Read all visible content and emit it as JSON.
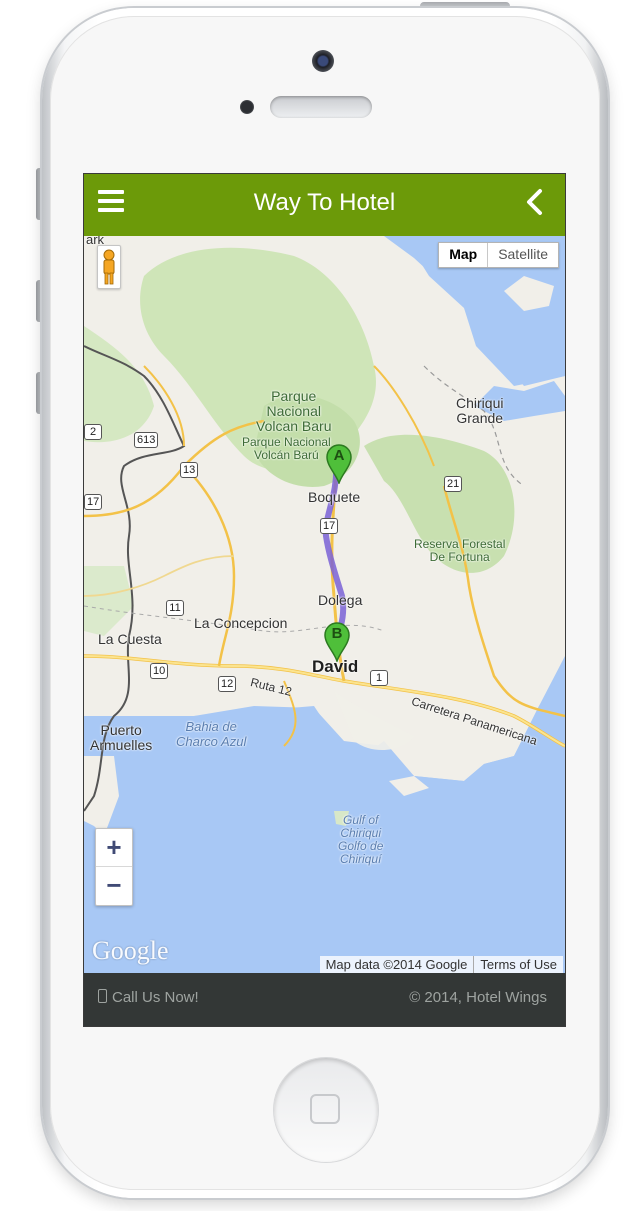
{
  "app": {
    "title": "Way To Hotel",
    "menu_icon": "hamburger-menu-icon",
    "back_icon": "chevron-left-icon",
    "accent_color": "#6c9a09"
  },
  "map": {
    "type_buttons": {
      "map": "Map",
      "satellite": "Satellite",
      "active": "Map"
    },
    "zoom_in": "+",
    "zoom_out": "−",
    "logo": "Google",
    "attribution": {
      "data": "Map data ©2014 Google",
      "terms": "Terms of Use"
    },
    "markers": {
      "start": "A",
      "end": "B"
    },
    "labels": {
      "park1": "Parque\nNacional\nVolcan Baru",
      "park2": "Parque Nacional\nVolcán Barú",
      "boquete": "Boquete",
      "chiriqui_grande": "Chiriqui\nGrande",
      "reserva": "Reserva Forestal\nDe Fortuna",
      "dolega": "Dolega",
      "la_concepcion": "La Concepcion",
      "la_cuesta": "La Cuesta",
      "david": "David",
      "ruta12": "Ruta 12",
      "carretera": "Carretera Panamericana",
      "puerto": "Puerto\nArmuelles",
      "bahia": "Bahia de\nCharco Azul",
      "gulf": "Gulf of\nChiriqui\nGolfo de\nChiriquí",
      "park_edge": "ark"
    },
    "road_shields": {
      "r613": "613",
      "r13": "13",
      "r17a": "17",
      "r17b": "17",
      "r21": "21",
      "r11": "11",
      "r12": "12",
      "r1": "1",
      "r2": "2",
      "r10": "10"
    }
  },
  "footer": {
    "call": "Call Us Now!",
    "copyright": "© 2014, Hotel Wings"
  }
}
